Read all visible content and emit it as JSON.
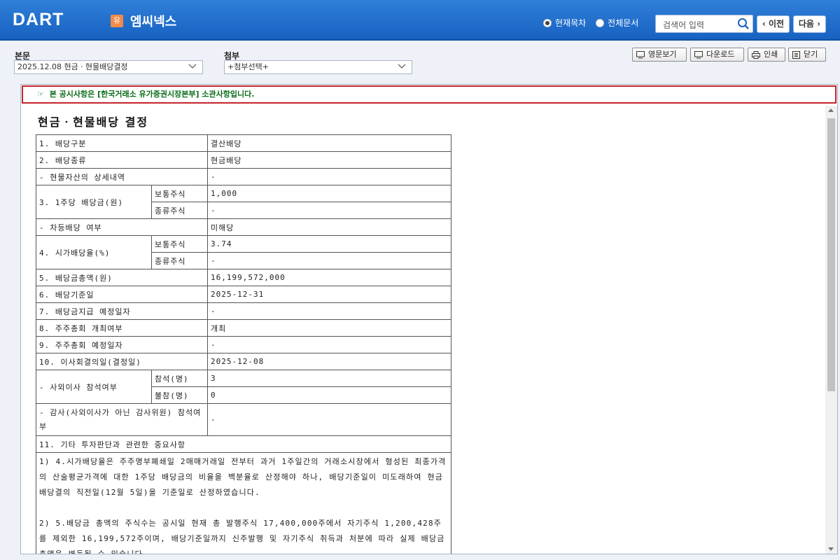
{
  "header": {
    "logo": "DART",
    "company_badge": "유",
    "company_name": "엠씨넥스",
    "scope_current": "현재목차",
    "scope_all": "전체문서",
    "search_placeholder": "검색어 입력",
    "prev_label": "이전",
    "next_label": "다음"
  },
  "toolbar": {
    "main_label": "본문",
    "main_select": "2025.12.08  현금ㆍ현물배당결정",
    "attach_label": "첨부",
    "attach_select": "+첨부선택+",
    "btn_english": "영문보기",
    "btn_download": "다운로드",
    "btn_print": "인쇄",
    "btn_close": "닫기"
  },
  "document": {
    "notice": "본 공시사항은 [한국거래소 유가증권시장본부] 소관사항입니다.",
    "title": "현금ㆍ현물배당 결정",
    "rows": {
      "r1_label": "1. 배당구분",
      "r1_value": "결산배당",
      "r2_label": "2. 배당종류",
      "r2_value": "현금배당",
      "r2a_label": "- 현물자산의 상세내역",
      "r2a_value": "-",
      "r3_label": "3. 1주당 배당금(원)",
      "r3_sub1": "보통주식",
      "r3_val1": "1,000",
      "r3_sub2": "종류주식",
      "r3_val2": "-",
      "r3a_label": "- 차등배당 여부",
      "r3a_value": "미해당",
      "r4_label": "4. 시가배당율(%)",
      "r4_sub1": "보통주식",
      "r4_val1": "3.74",
      "r4_sub2": "종류주식",
      "r4_val2": "-",
      "r5_label": "5. 배당금총액(원)",
      "r5_value": "16,199,572,000",
      "r6_label": "6. 배당기준일",
      "r6_value": "2025-12-31",
      "r7_label": "7. 배당금지급 예정일자",
      "r7_value": "-",
      "r8_label": "8. 주주총회 개최여부",
      "r8_value": "개최",
      "r9_label": "9. 주주총회 예정일자",
      "r9_value": "-",
      "r10_label": "10. 이사회결의일(결정일)",
      "r10_value": "2025-12-08",
      "r10a_label": "- 사외이사 참석여부",
      "r10a_sub1": "참석(명)",
      "r10a_val1": "3",
      "r10a_sub2": "불참(명)",
      "r10a_val2": "0",
      "r10b_label": "- 감사(사외이사가 아닌 감사위원) 참석여부",
      "r10b_value": "-",
      "r11_label": "11. 기타 투자판단과 관련한 중요사항"
    },
    "note1": "1) 4.시가배당율은 주주명부폐쇄일 2매매거래일 전부터 과거 1주일간의 거래소시장에서 형성된 최종가격의 산술평균가격에 대한 1주당 배당금의 비율을 백분율로 산정해야 하나, 배당기준일이 미도래하여 현금배당결의 직전일(12월 5일)을 기준일로 산정하였습니다.",
    "note2": "2) 5.배당금 총액의 주식수는 공시일 현재 총 발행주식 17,400,000주에서 자기주식 1,200,428주를 제외한 16,199,572주이며, 배당기준일까지 신주발행 및 자기주식 취득과 처분에 따라 실제 배당금 총액은 변동될 수 있습니다."
  }
}
